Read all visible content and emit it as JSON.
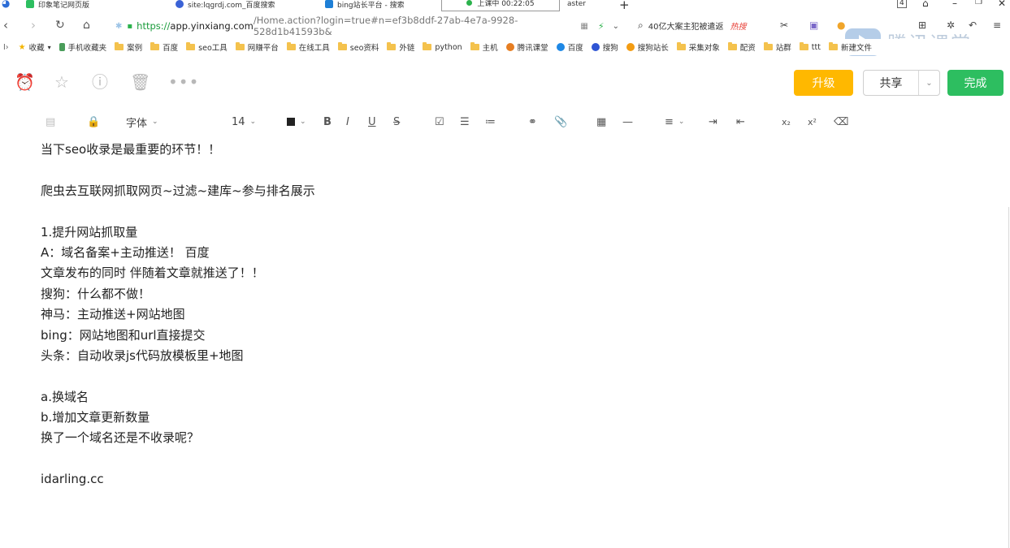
{
  "browser": {
    "tabs": [
      {
        "label": "印象笔记网页版",
        "color": "#2dbe60"
      },
      {
        "label": "site:lqgrdj.com_百度搜索",
        "color": "#3a62d6"
      },
      {
        "label": "bing站长平台 - 搜索",
        "color": "#1e7fd6"
      }
    ],
    "live_badge": "上课中 00:22:05",
    "partial_tab": "aster",
    "tab_count": "4",
    "address": {
      "scheme": "https://",
      "host": "app.yinxiang.com",
      "rest": "/Home.action?login=true#n=ef3b8ddf-27ab-4e7a-9928-528d1b41593b&"
    },
    "search_hint": "40亿大案主犯被遣返",
    "search_hot": "热搜",
    "tencent_label": "腾讯课堂"
  },
  "bookmarks": [
    {
      "label": "收藏",
      "type": "star"
    },
    {
      "label": "手机收藏夹",
      "type": "phone"
    },
    {
      "label": "案例",
      "type": "folder"
    },
    {
      "label": "百度",
      "type": "folder"
    },
    {
      "label": "seo工具",
      "type": "folder"
    },
    {
      "label": "网赚平台",
      "type": "folder"
    },
    {
      "label": "在线工具",
      "type": "folder"
    },
    {
      "label": "seo资料",
      "type": "folder"
    },
    {
      "label": "外链",
      "type": "folder"
    },
    {
      "label": "python",
      "type": "folder"
    },
    {
      "label": "主机",
      "type": "folder"
    },
    {
      "label": "腾讯课堂",
      "type": "site"
    },
    {
      "label": "百度",
      "type": "site"
    },
    {
      "label": "搜狗",
      "type": "site"
    },
    {
      "label": "搜狗站长",
      "type": "site"
    },
    {
      "label": "采集对象",
      "type": "folder"
    },
    {
      "label": "配资",
      "type": "folder"
    },
    {
      "label": "站群",
      "type": "folder"
    },
    {
      "label": "ttt",
      "type": "folder"
    },
    {
      "label": "新建文件",
      "type": "folder"
    }
  ],
  "note_toolbar": {
    "upgrade": "升级",
    "share": "共享",
    "done": "完成"
  },
  "format": {
    "font": "字体",
    "size": "14"
  },
  "note_lines": [
    "当下seo收录是最重要的环节！！",
    "",
    "爬虫去互联网抓取网页~过滤~建库~参与排名展示",
    "",
    "1.提升网站抓取量",
    "A：域名备案+主动推送！ 百度",
    "文章发布的同时 伴随着文章就推送了！！",
    "搜狗：什么都不做！",
    "神马：主动推送+网站地图",
    "bing：网站地图和url直接提交",
    "头条：自动收录js代码放模板里+地图",
    "",
    "a.换域名",
    "b.增加文章更新数量",
    "换了一个域名还是不收录呢？",
    "",
    "idarling.cc"
  ]
}
